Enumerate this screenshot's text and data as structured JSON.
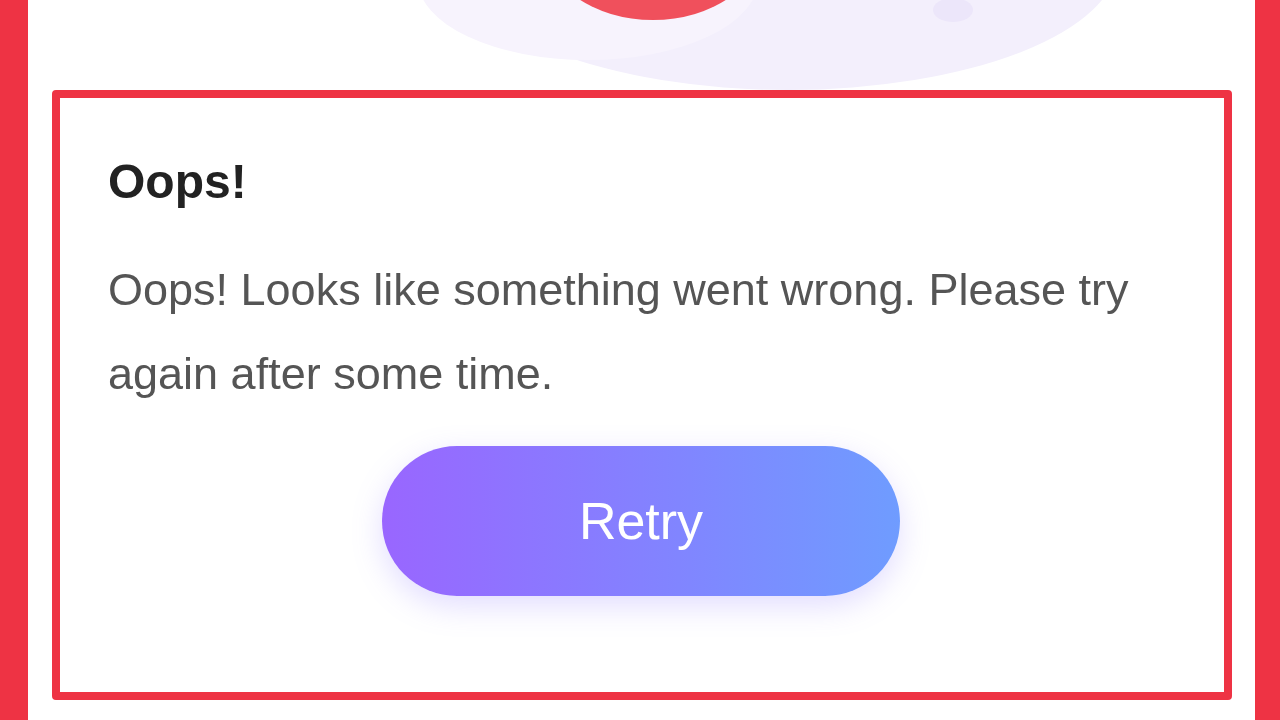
{
  "dialog": {
    "title": "Oops!",
    "message": "Oops! Looks like something went wrong. Please try again after some time.",
    "button": "Retry"
  }
}
